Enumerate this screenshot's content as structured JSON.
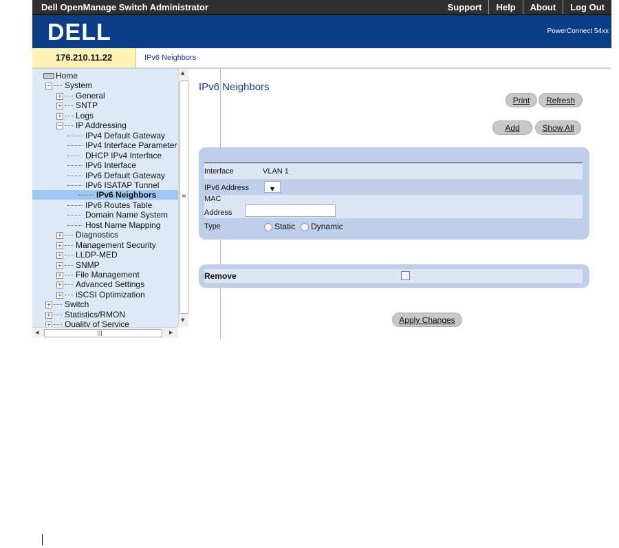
{
  "topbar": {
    "title": "Dell OpenManage Switch Administrator",
    "links": [
      "Support",
      "Help",
      "About",
      "Log Out"
    ]
  },
  "banner": {
    "logo": "DELL",
    "model": "PowerConnect 54xx"
  },
  "ipbar": {
    "ip": "176.210.11.22",
    "breadcrumb": "IPv6 Neighbors"
  },
  "tree": [
    {
      "label": "Home",
      "icon": "drive-icon"
    },
    {
      "label": "System",
      "expander": "−"
    },
    {
      "label": "General",
      "expander": "+"
    },
    {
      "label": "SNTP",
      "expander": "+"
    },
    {
      "label": "Logs",
      "expander": "+"
    },
    {
      "label": "IP Addressing",
      "expander": "−"
    },
    {
      "label": "IPv4 Default Gateway"
    },
    {
      "label": "IPv4 Interface Parameter"
    },
    {
      "label": "DHCP IPv4 Interface"
    },
    {
      "label": "IPv6 Interface"
    },
    {
      "label": "IPv6 Default Gateway"
    },
    {
      "label": "IPv6 ISATAP Tunnel"
    },
    {
      "label": "IPv6 Neighbors",
      "selected": true
    },
    {
      "label": "IPv6 Routes Table"
    },
    {
      "label": "Domain Name System"
    },
    {
      "label": "Host Name Mapping"
    },
    {
      "label": "Diagnostics",
      "expander": "+"
    },
    {
      "label": "Management Security",
      "expander": "+"
    },
    {
      "label": "LLDP-MED",
      "expander": "+"
    },
    {
      "label": "SNMP",
      "expander": "+"
    },
    {
      "label": "File Management",
      "expander": "+"
    },
    {
      "label": "Advanced Settings",
      "expander": "+"
    },
    {
      "label": "iSCSI Optimization",
      "expander": "+"
    },
    {
      "label": "Switch",
      "expander": "+"
    },
    {
      "label": "Statistics/RMON",
      "expander": "+"
    },
    {
      "label": "Quality of Service",
      "expander": "+"
    }
  ],
  "page": {
    "title": "IPv6 Neighbors",
    "buttons": {
      "print": "Print",
      "refresh": "Refresh",
      "add": "Add",
      "show_all": "Show All",
      "apply": "Apply Changes"
    }
  },
  "form": {
    "interface_label": "Interface",
    "interface_value": "VLAN 1",
    "ipv6_label": "IPv6 Address",
    "mac_label": "MAC",
    "address_label": "Address",
    "mac_address_value": "",
    "type_label": "Type",
    "type_options": [
      "Static",
      "Dynamic"
    ]
  },
  "remove": {
    "label": "Remove",
    "checked": false
  },
  "colors": {
    "banner": "#0b3e86",
    "panel": "#bfcfe9",
    "tree_bg": "#dce9f7"
  }
}
